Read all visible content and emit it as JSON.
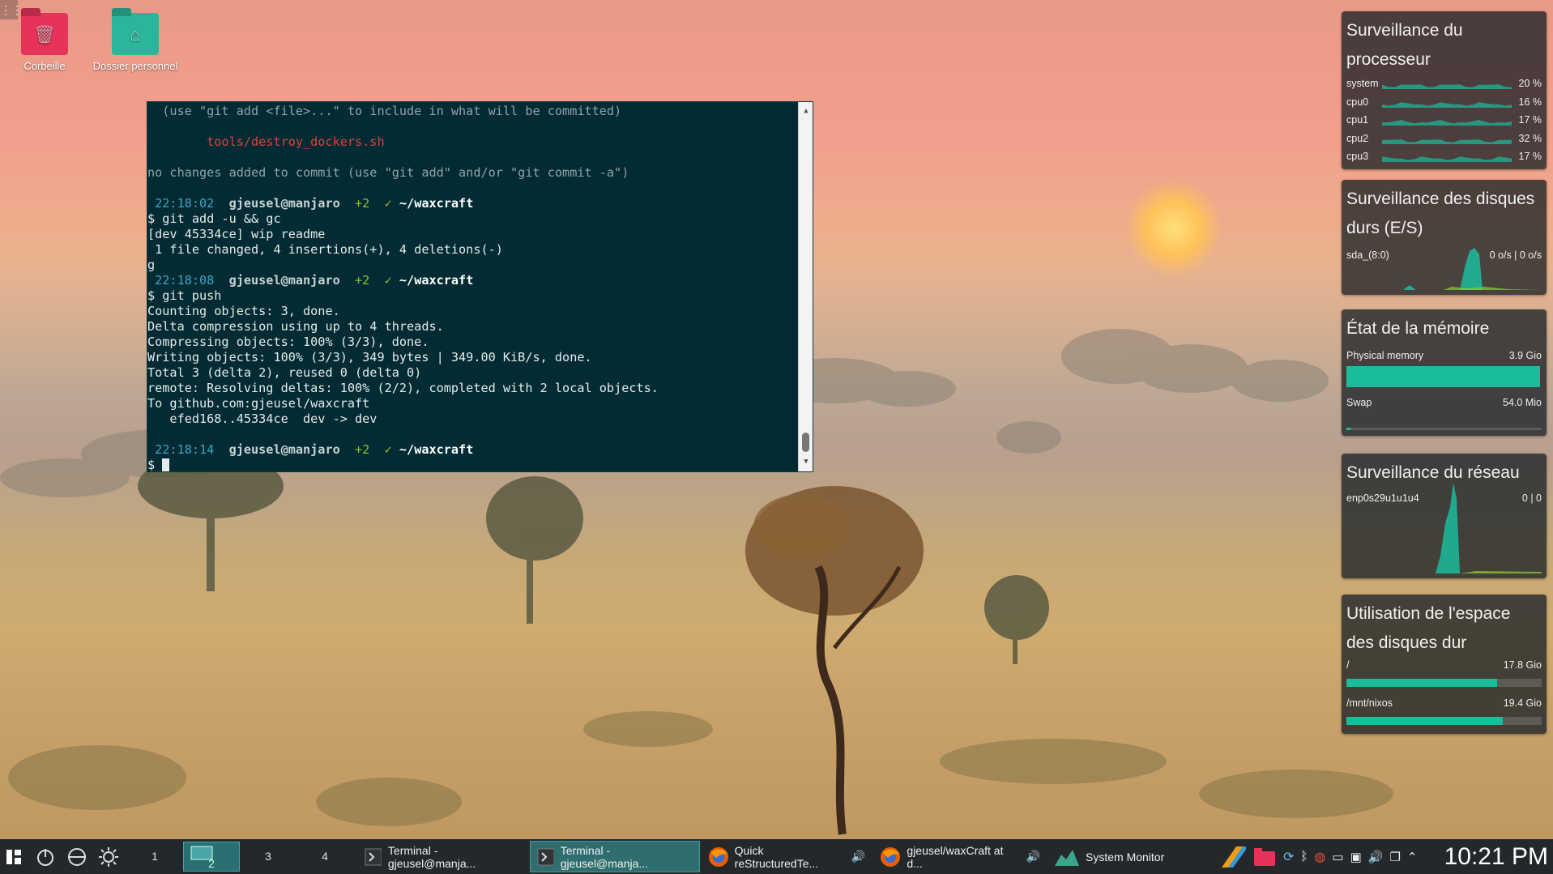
{
  "desktop": {
    "icons": [
      {
        "label": "Corbeille",
        "icon": "trash-folder-icon",
        "color": "#e7335a"
      },
      {
        "label": "Dossier personnel",
        "icon": "home-folder-icon",
        "color": "#2bb59a"
      }
    ],
    "menu_grip": "⋮⋮"
  },
  "terminal": {
    "lines": [
      {
        "parts": [
          {
            "t": "  (use \"git add <file>...\" to include in what will be committed)",
            "c": "t-dim"
          }
        ]
      },
      {
        "parts": [
          {
            "t": "",
            "c": ""
          }
        ]
      },
      {
        "parts": [
          {
            "t": "        tools/destroy_dockers.sh",
            "c": "t-red"
          }
        ]
      },
      {
        "parts": [
          {
            "t": "",
            "c": ""
          }
        ]
      },
      {
        "parts": [
          {
            "t": "no changes added to commit (use \"git add\" and/or \"git commit -a\")",
            "c": "t-dim"
          }
        ]
      },
      {
        "parts": [
          {
            "t": "",
            "c": ""
          }
        ]
      },
      {
        "parts": [
          {
            "t": " 22:18:02",
            "c": "t-time"
          },
          {
            "t": "  gjeusel@manjaro",
            "c": "t-user"
          },
          {
            "t": "  +2  ✓",
            "c": "t-green"
          },
          {
            "t": " ~/waxcraft",
            "c": "t-bold"
          }
        ]
      },
      {
        "parts": [
          {
            "t": "$ git add -u && gc",
            "c": ""
          }
        ]
      },
      {
        "parts": [
          {
            "t": "[dev 45334ce] wip readme",
            "c": ""
          }
        ]
      },
      {
        "parts": [
          {
            "t": " 1 file changed, 4 insertions(+), 4 deletions(-)",
            "c": ""
          }
        ]
      },
      {
        "parts": [
          {
            "t": "g",
            "c": ""
          }
        ]
      },
      {
        "parts": [
          {
            "t": " 22:18:08",
            "c": "t-time"
          },
          {
            "t": "  gjeusel@manjaro",
            "c": "t-user"
          },
          {
            "t": "  +2  ✓",
            "c": "t-green"
          },
          {
            "t": " ~/waxcraft",
            "c": "t-bold"
          }
        ]
      },
      {
        "parts": [
          {
            "t": "$ git push",
            "c": ""
          }
        ]
      },
      {
        "parts": [
          {
            "t": "Counting objects: 3, done.",
            "c": ""
          }
        ]
      },
      {
        "parts": [
          {
            "t": "Delta compression using up to 4 threads.",
            "c": ""
          }
        ]
      },
      {
        "parts": [
          {
            "t": "Compressing objects: 100% (3/3), done.",
            "c": ""
          }
        ]
      },
      {
        "parts": [
          {
            "t": "Writing objects: 100% (3/3), 349 bytes | 349.00 KiB/s, done.",
            "c": ""
          }
        ]
      },
      {
        "parts": [
          {
            "t": "Total 3 (delta 2), reused 0 (delta 0)",
            "c": ""
          }
        ]
      },
      {
        "parts": [
          {
            "t": "remote: Resolving deltas: 100% (2/2), completed with 2 local objects.",
            "c": ""
          }
        ]
      },
      {
        "parts": [
          {
            "t": "To github.com:gjeusel/waxcraft",
            "c": ""
          }
        ]
      },
      {
        "parts": [
          {
            "t": "   efed168..45334ce  dev -> dev",
            "c": ""
          }
        ]
      },
      {
        "parts": [
          {
            "t": "",
            "c": ""
          }
        ]
      },
      {
        "parts": [
          {
            "t": " 22:18:14",
            "c": "t-time"
          },
          {
            "t": "  gjeusel@manjaro",
            "c": "t-user"
          },
          {
            "t": "  +2  ✓",
            "c": "t-green"
          },
          {
            "t": " ~/waxcraft",
            "c": "t-bold"
          }
        ]
      }
    ],
    "prompt": "$ ",
    "scroll_up": "▲",
    "scroll_down": "▼",
    "scroll_position": 0.97
  },
  "widgets": {
    "cpu": {
      "title": "Surveillance du processeur",
      "rows": [
        {
          "name": "system",
          "value": "20 %"
        },
        {
          "name": "cpu0",
          "value": "16 %"
        },
        {
          "name": "cpu1",
          "value": "17 %"
        },
        {
          "name": "cpu2",
          "value": "32 %"
        },
        {
          "name": "cpu3",
          "value": "17 %"
        }
      ]
    },
    "disk_io": {
      "title": "Surveillance des disques durs (E/S)",
      "device": "sda_(8:0)",
      "value": "0 o/s | 0 o/s"
    },
    "memory": {
      "title": "État de la mémoire",
      "physical_label": "Physical memory",
      "physical_value": "3.9 Gio",
      "physical_fraction": 0.99,
      "swap_label": "Swap",
      "swap_value": "54.0 Mio",
      "swap_fraction": 0.02
    },
    "network": {
      "title": "Surveillance du réseau",
      "interface": "enp0s29u1u1u4",
      "value": "0 | 0"
    },
    "disk_usage": {
      "title": "Utilisation de l'espace des disques dur",
      "mounts": [
        {
          "path": "/",
          "value": "17.8 Gio",
          "fraction": 0.77
        },
        {
          "path": "/mnt/nixos",
          "value": "19.4 Gio",
          "fraction": 0.8
        }
      ]
    },
    "accent": "#1abc9c"
  },
  "taskbar": {
    "launcher_icon": "application-menu-icon",
    "power_icon": "power-icon",
    "desktops": [
      "1",
      "2",
      "3",
      "4"
    ],
    "active_desktop": "2",
    "tasks": [
      {
        "label": "Terminal - gjeusel@manja...",
        "icon": "terminal-icon",
        "active": false
      },
      {
        "label": "Terminal - gjeusel@manja...",
        "icon": "terminal-icon",
        "active": true
      },
      {
        "label": "Quick reStructuredTe...",
        "icon": "firefox-icon",
        "active": false,
        "audio": true
      },
      {
        "label": "gjeusel/waxCraft at d...",
        "icon": "firefox-icon",
        "active": false,
        "audio": true
      },
      {
        "label": "System Monitor",
        "icon": "system-monitor-icon",
        "active": false
      }
    ],
    "clock": "10:21 PM"
  }
}
